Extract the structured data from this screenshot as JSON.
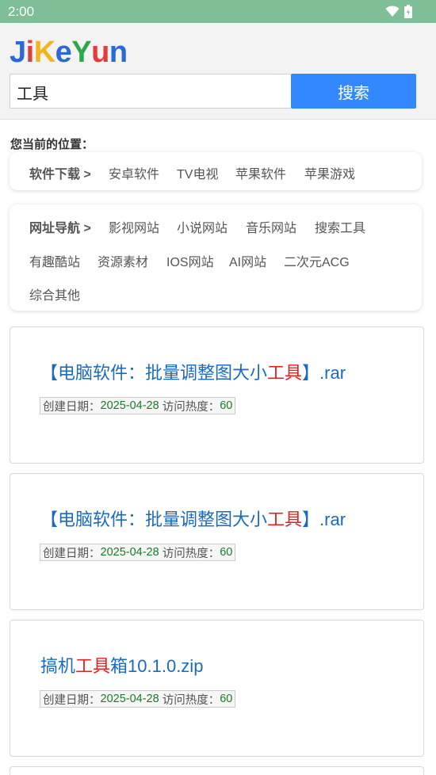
{
  "status_bar": {
    "time": "2:00"
  },
  "header": {
    "logo": {
      "J": "J",
      "i": "i",
      "K": "K",
      "e": "e",
      "Y": "Y",
      "u": "u",
      "n": "n"
    },
    "search_value": "工具",
    "search_button": "搜索"
  },
  "location_label": "您当前的位置：",
  "software_nav": {
    "heading": "软件下载 >",
    "links": [
      "安卓软件",
      "TV电视",
      "苹果软件",
      "苹果游戏"
    ]
  },
  "site_nav": {
    "heading": "网址导航 >",
    "links": [
      "影视网站",
      "小说网站",
      "音乐网站",
      "搜索工具",
      "有趣酷站",
      "资源素材",
      "IOS网站",
      "AI网站",
      "二次元ACG",
      "综合其他"
    ]
  },
  "results": [
    {
      "title_pre": "【电脑软件：批量调整图大小",
      "title_hl": "工具",
      "title_post": "】.rar",
      "date_label": "创建日期：",
      "date": "2025-04-28",
      "heat_label": "访问热度：",
      "heat": "60"
    },
    {
      "title_pre": "【电脑软件：批量调整图大小",
      "title_hl": "工具",
      "title_post": "】.rar",
      "date_label": "创建日期：",
      "date": "2025-04-28",
      "heat_label": "访问热度：",
      "heat": "60"
    },
    {
      "title_pre": "搞机",
      "title_hl": "工具",
      "title_post": "箱10.1.0.zip",
      "date_label": "创建日期：",
      "date": "2025-04-28",
      "heat_label": "访问热度：",
      "heat": "60"
    }
  ],
  "colors": {
    "status_bar": "#7fbf98",
    "search_button": "#3388ff",
    "link_blue": "#1a6bbf",
    "highlight_red": "#e02020",
    "meta_green": "#1a7a2a",
    "logo_J": "#2a6ad8",
    "logo_i": "#e23c3c",
    "logo_K": "#f2b51b",
    "logo_e": "#2a6ad8",
    "logo_Y": "#2aa84a",
    "logo_u": "#e23c3c",
    "logo_n": "#2a6ad8"
  }
}
